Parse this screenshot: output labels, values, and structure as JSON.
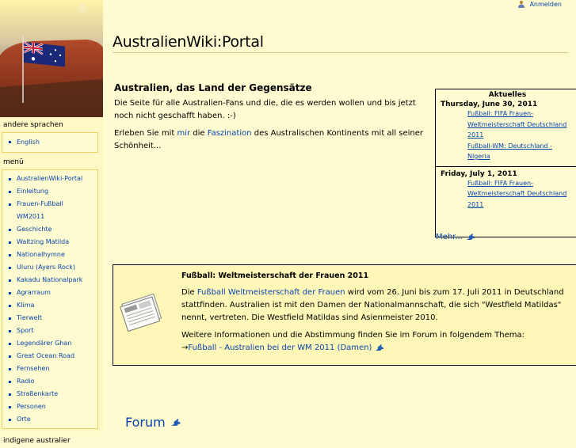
{
  "header": {
    "login_label": "Anmelden"
  },
  "page": {
    "title": "AustralienWiki:Portal"
  },
  "sidebar": {
    "languages_heading": "andere sprachen",
    "languages": [
      {
        "label": "English"
      }
    ],
    "menu_heading": "menü",
    "menu": [
      {
        "label": "AustralienWiki-Portal"
      },
      {
        "label": "Einleitung"
      },
      {
        "label": "Frauen-Fußball WM2011"
      },
      {
        "label": "Geschichte"
      },
      {
        "label": "Waltzing Matilda"
      },
      {
        "label": "Nationalhymne"
      },
      {
        "label": "Uluru (Ayers Rock)"
      },
      {
        "label": "Kakadu Nationalpark"
      },
      {
        "label": "Agrarraum"
      },
      {
        "label": "Klima"
      },
      {
        "label": "Tierwelt"
      },
      {
        "label": "Sport"
      },
      {
        "label": "Legendärer Ghan"
      },
      {
        "label": "Great Ocean Road"
      },
      {
        "label": "Fernsehen"
      },
      {
        "label": "Radio"
      },
      {
        "label": "Straßenkarte"
      },
      {
        "label": "Personen"
      },
      {
        "label": "Orte"
      }
    ],
    "next_heading": "indigene australier"
  },
  "intro": {
    "heading": "Australien, das Land der Gegensätze",
    "p1": "Die Seite für alle Australien-Fans und die, die es werden wollen und bis jetzt noch nicht geschafft haben. :-)",
    "p2_before": "Erleben Sie mit ",
    "p2_link1": "mir",
    "p2_mid": " die ",
    "p2_link2": "Faszination",
    "p2_after": " des Australischen Kontinents mit all seiner Schönheit..."
  },
  "news": {
    "heading": "Aktuelles",
    "date1": "Thursday, June 30, 2011",
    "items1": [
      "Fußball: FIFA Frauen-Weltmeisterschaft Deutschland 2011",
      "Fußball-WM: Deutschland - Nigeria"
    ],
    "date2": "Friday, July 1, 2011",
    "items2": [
      "Fußball: FIFA Frauen-Weltmeisterschaft Deutschland 2011"
    ],
    "more": "Mehr..."
  },
  "football": {
    "heading": "Fußball: Weltmeisterschaft der Frauen 2011",
    "p1_before": "Die ",
    "p1_link": "Fußball Weltmeisterschaft der Frauen",
    "p1_after": " wird vom 26. Juni bis zum 17. Juli 2011 in Deutschland stattfinden. Australien ist mit den Damen der Nationalmannschaft, die sich \"Westfield Matildas\" nennt, vertreten. Die Westfield Matildas sind Asienmeister 2010.",
    "p2": "Weitere Informationen und die Abstimmung finden Sie im Forum in folgendem Thema:",
    "arrow": "→",
    "p2_link": "Fußball - Australien bei der WM 2011 (Damen)"
  },
  "forum": {
    "label": "Forum"
  },
  "colors": {
    "background": "#fffbd0",
    "link": "#0645ad",
    "box_border": "#000000"
  }
}
